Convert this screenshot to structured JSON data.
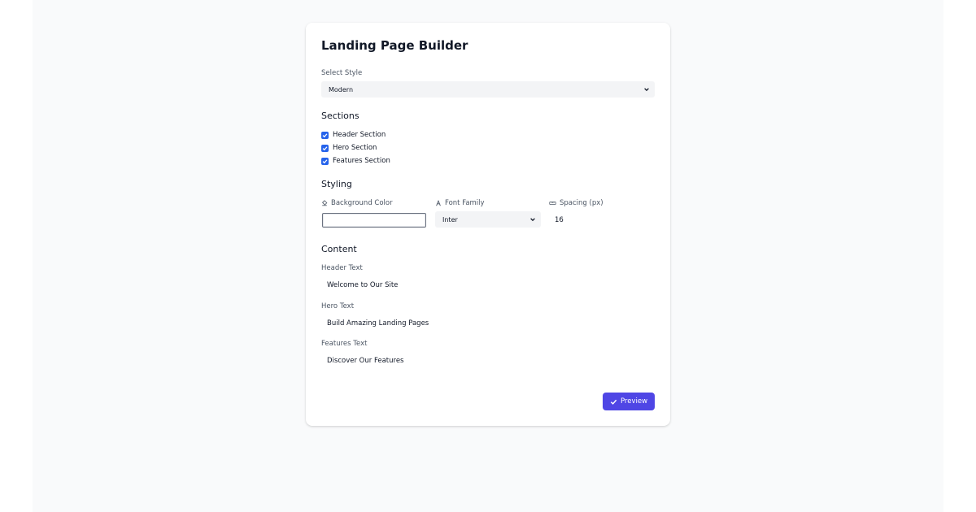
{
  "app": {
    "title": "Landing Page Builder"
  },
  "style": {
    "label": "Select Style",
    "value": "Modern"
  },
  "sections": {
    "heading": "Sections",
    "items": [
      {
        "label": "Header Section",
        "checked": true
      },
      {
        "label": "Hero Section",
        "checked": true
      },
      {
        "label": "Features Section",
        "checked": true
      }
    ]
  },
  "styling": {
    "heading": "Styling",
    "background_color": {
      "label": "Background Color",
      "icon": "paint-bucket-icon",
      "value": ""
    },
    "font_family": {
      "label": "Font Family",
      "icon": "font-icon",
      "value": "Inter"
    },
    "spacing": {
      "label": "Spacing (px)",
      "icon": "ruler-icon",
      "value": "16"
    }
  },
  "content": {
    "heading": "Content",
    "header_text": {
      "label": "Header Text",
      "value": "Welcome to Our Site"
    },
    "hero_text": {
      "label": "Hero Text",
      "value": "Build Amazing Landing Pages"
    },
    "features_text": {
      "label": "Features Text",
      "value": "Discover Our Features"
    }
  },
  "actions": {
    "preview_label": "Preview",
    "preview_icon": "check-icon"
  },
  "colors": {
    "accent": "#4f46e5",
    "checkbox": "#2563eb",
    "page_bg": "#f9fafb",
    "card_bg": "#ffffff"
  }
}
